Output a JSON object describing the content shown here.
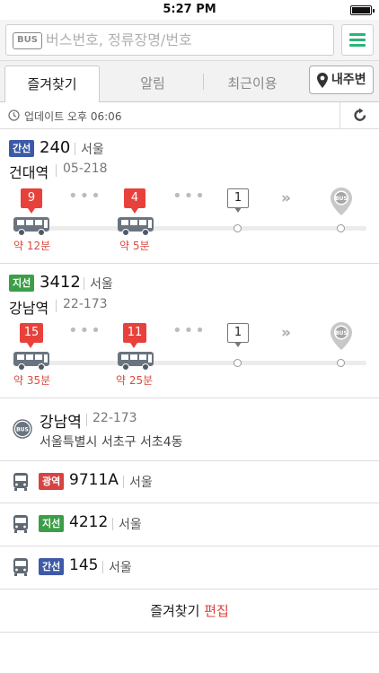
{
  "status_bar": {
    "time": "5:27 PM"
  },
  "search": {
    "tag": "BUS",
    "placeholder": "버스번호, 정류장명/번호"
  },
  "tabs": [
    {
      "label": "즐겨찾기"
    },
    {
      "label": "알림"
    },
    {
      "label": "최근이용"
    }
  ],
  "near_button": {
    "label": "내주변"
  },
  "update": {
    "text": "업데이트 오후 06:06"
  },
  "cards": [
    {
      "type_label": "간선",
      "route": "240",
      "region": "서울",
      "stop_name": "건대역",
      "stop_code": "05-218",
      "stops_away": [
        "9",
        "4",
        "1"
      ],
      "etas": [
        "약 12분",
        "약 5분"
      ],
      "end_icon": "BUS"
    },
    {
      "type_label": "지선",
      "route": "3412",
      "region": "서울",
      "stop_name": "강남역",
      "stop_code": "22-173",
      "stops_away": [
        "15",
        "11",
        "1"
      ],
      "etas": [
        "약 35분",
        "약 25분"
      ],
      "end_icon": "BUS"
    }
  ],
  "stop_row": {
    "icon_label": "BUS",
    "name": "강남역",
    "code": "22-173",
    "address": "서울특별시 서초구 서초4동"
  },
  "route_rows": [
    {
      "type_label": "광역",
      "route": "9711A",
      "region": "서울"
    },
    {
      "type_label": "지선",
      "route": "4212",
      "region": "서울"
    },
    {
      "type_label": "간선",
      "route": "145",
      "region": "서울"
    }
  ],
  "footer": {
    "label": "즐겨찾기",
    "edit": "편집"
  },
  "colors": {
    "accent_green": "#2db37a",
    "trunk_blue": "#3d5aa8",
    "branch_green": "#3c9e48",
    "express_red": "#d74343",
    "marker_red": "#e8413b",
    "eta_red": "#d94c41"
  }
}
